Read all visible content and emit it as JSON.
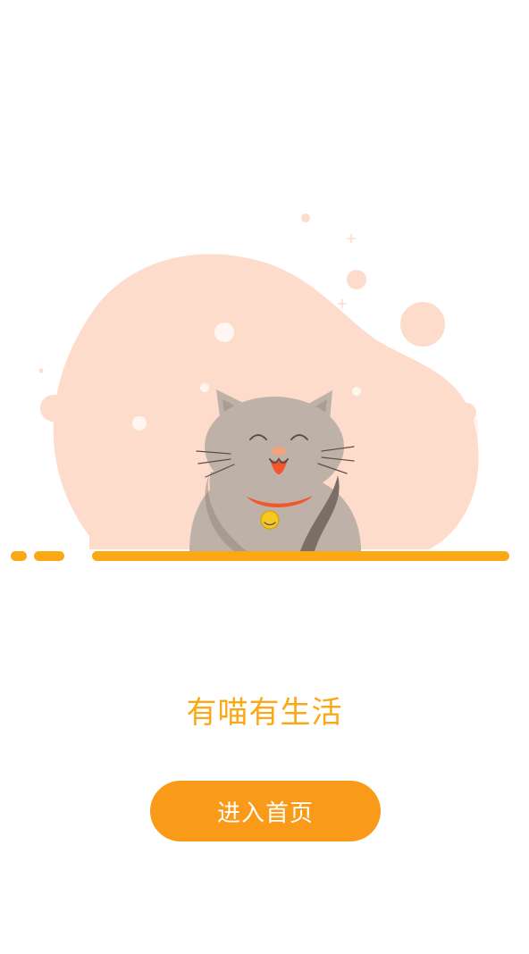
{
  "splash": {
    "illustration": "cat-illustration",
    "tagline": "有喵有生活",
    "enter_button_label": "进入首页"
  },
  "colors": {
    "accent": "#fba816",
    "button": "#f99a18",
    "blob": "#fddccb",
    "cat_body": "#bdb1a8",
    "collar": "#f4552d",
    "bell": "#f5c823"
  }
}
